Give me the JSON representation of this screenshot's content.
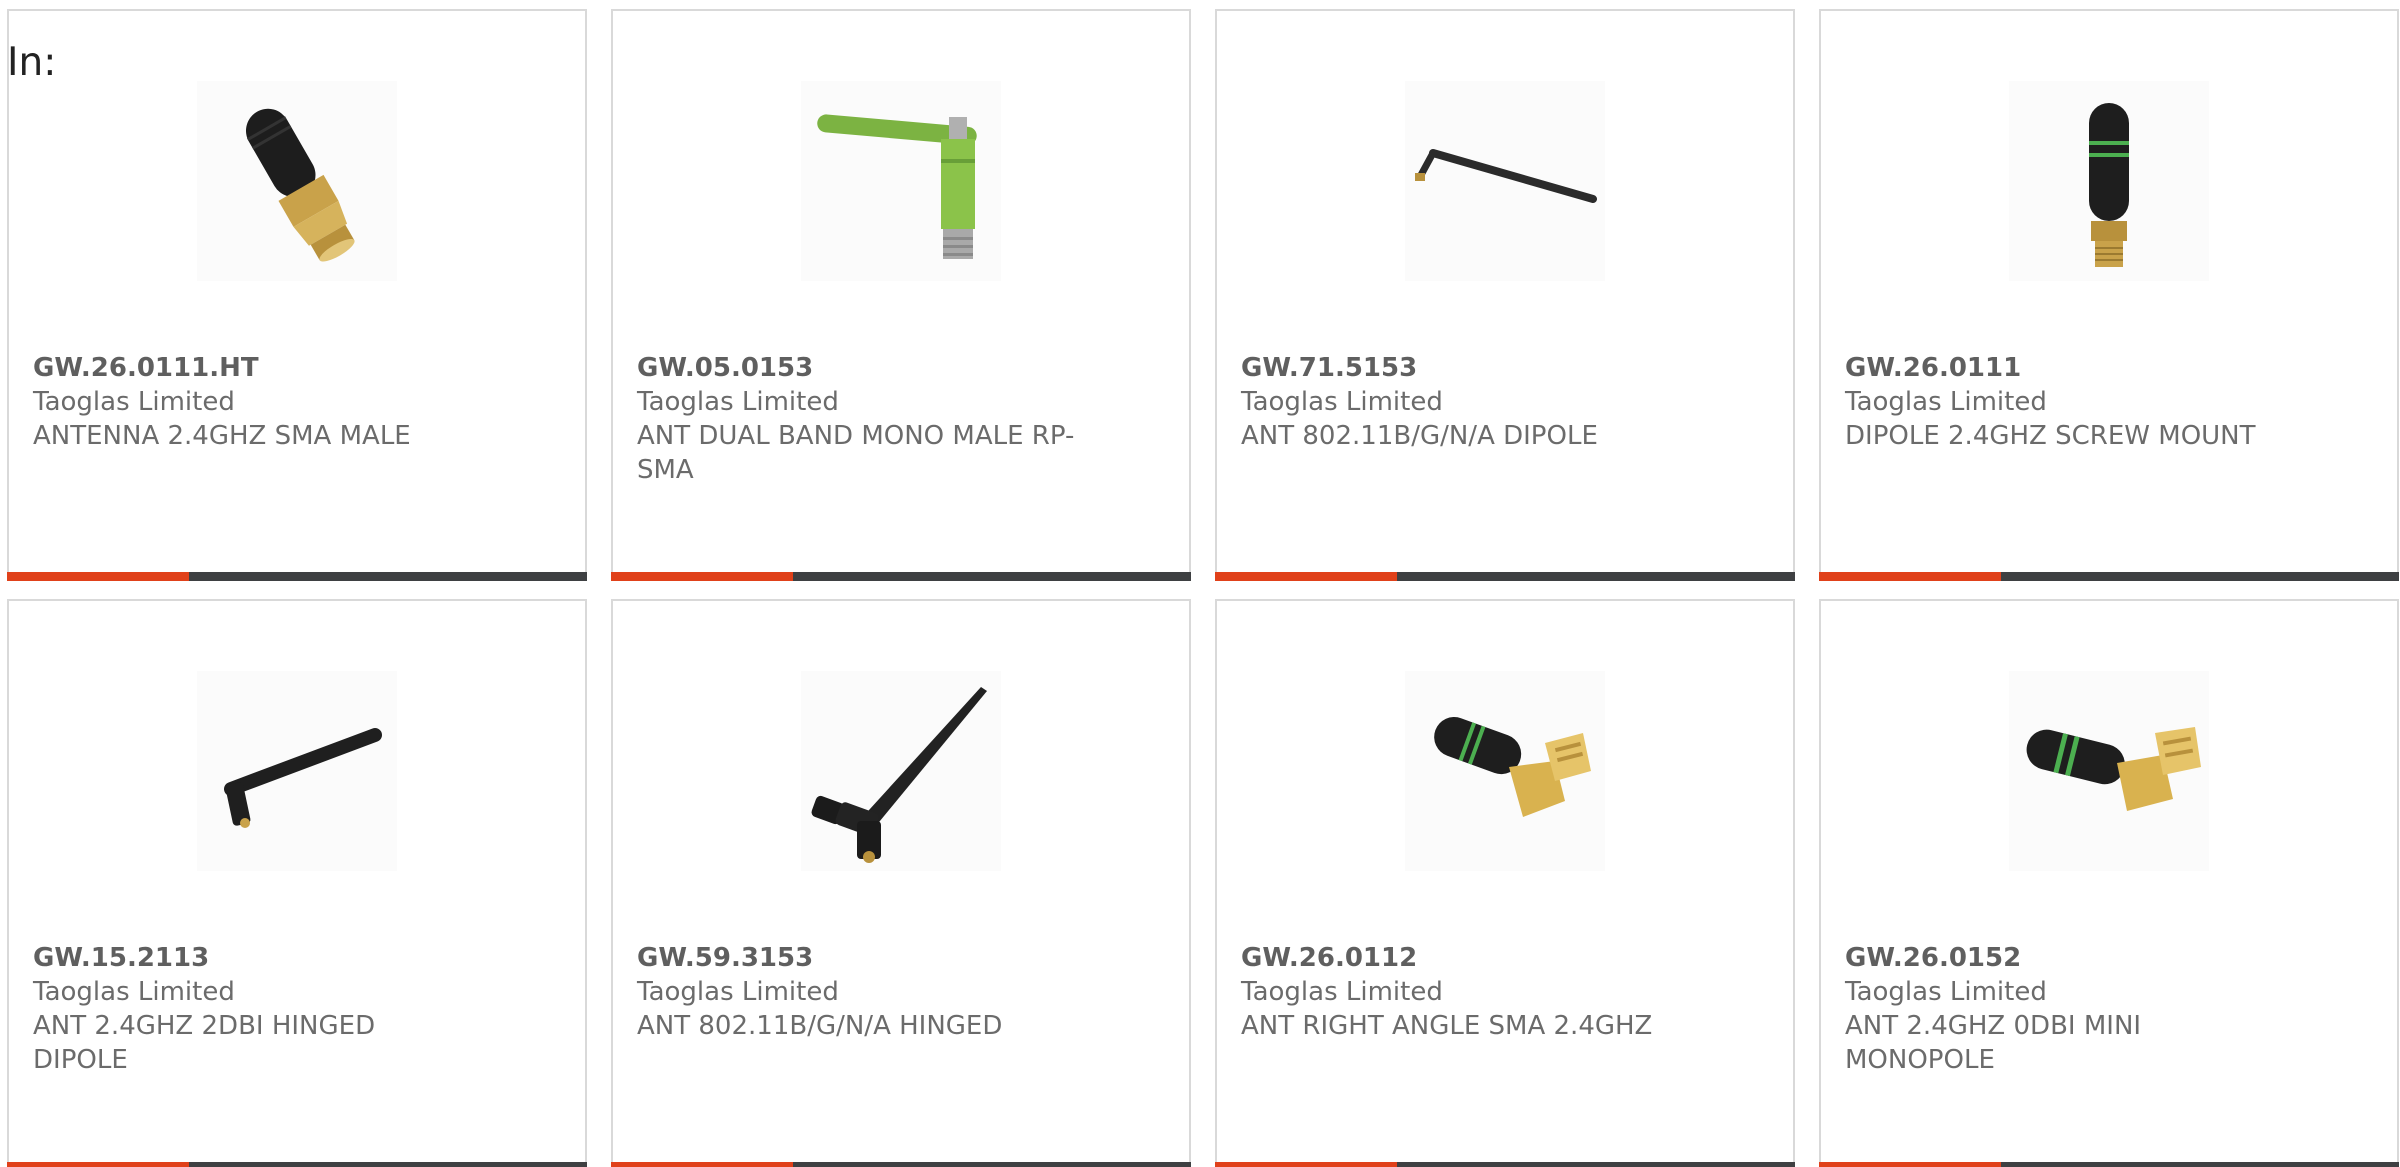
{
  "header": {
    "label": "In:"
  },
  "products": [
    {
      "part_number": "GW.26.0111.HT",
      "manufacturer": "Taoglas Limited",
      "description": "ANTENNA 2.4GHZ SMA MALE",
      "icon": "sma-stubby-black-gold-antenna-icon"
    },
    {
      "part_number": "GW.05.0153",
      "manufacturer": "Taoglas Limited",
      "description": "ANT DUAL BAND MONO MALE RP-SMA",
      "icon": "green-hinged-antenna-icon"
    },
    {
      "part_number": "GW.71.5153",
      "manufacturer": "Taoglas Limited",
      "description": "ANT 802.11B/G/N/A DIPOLE",
      "icon": "slim-dipole-antenna-icon"
    },
    {
      "part_number": "GW.26.0111",
      "manufacturer": "Taoglas Limited",
      "description": "DIPOLE 2.4GHZ SCREW MOUNT",
      "icon": "stubby-green-band-antenna-icon"
    },
    {
      "part_number": "GW.15.2113",
      "manufacturer": "Taoglas Limited",
      "description": "ANT 2.4GHZ 2DBI HINGED DIPOLE",
      "icon": "hinged-dipole-antenna-icon"
    },
    {
      "part_number": "GW.59.3153",
      "manufacturer": "Taoglas Limited",
      "description": "ANT 802.11B/G/N/A HINGED",
      "icon": "long-hinged-antenna-icon"
    },
    {
      "part_number": "GW.26.0112",
      "manufacturer": "Taoglas Limited",
      "description": "ANT RIGHT ANGLE SMA 2.4GHZ",
      "icon": "right-angle-sma-antenna-icon"
    },
    {
      "part_number": "GW.26.0152",
      "manufacturer": "Taoglas Limited",
      "description": "ANT 2.4GHZ 0DBI MINI MONOPOLE",
      "icon": "mini-monopole-right-angle-antenna-icon"
    }
  ],
  "colors": {
    "accent": "#e0411a",
    "bar": "#3e4042",
    "border": "#d9d9d9",
    "text": "#6b6b6b"
  }
}
